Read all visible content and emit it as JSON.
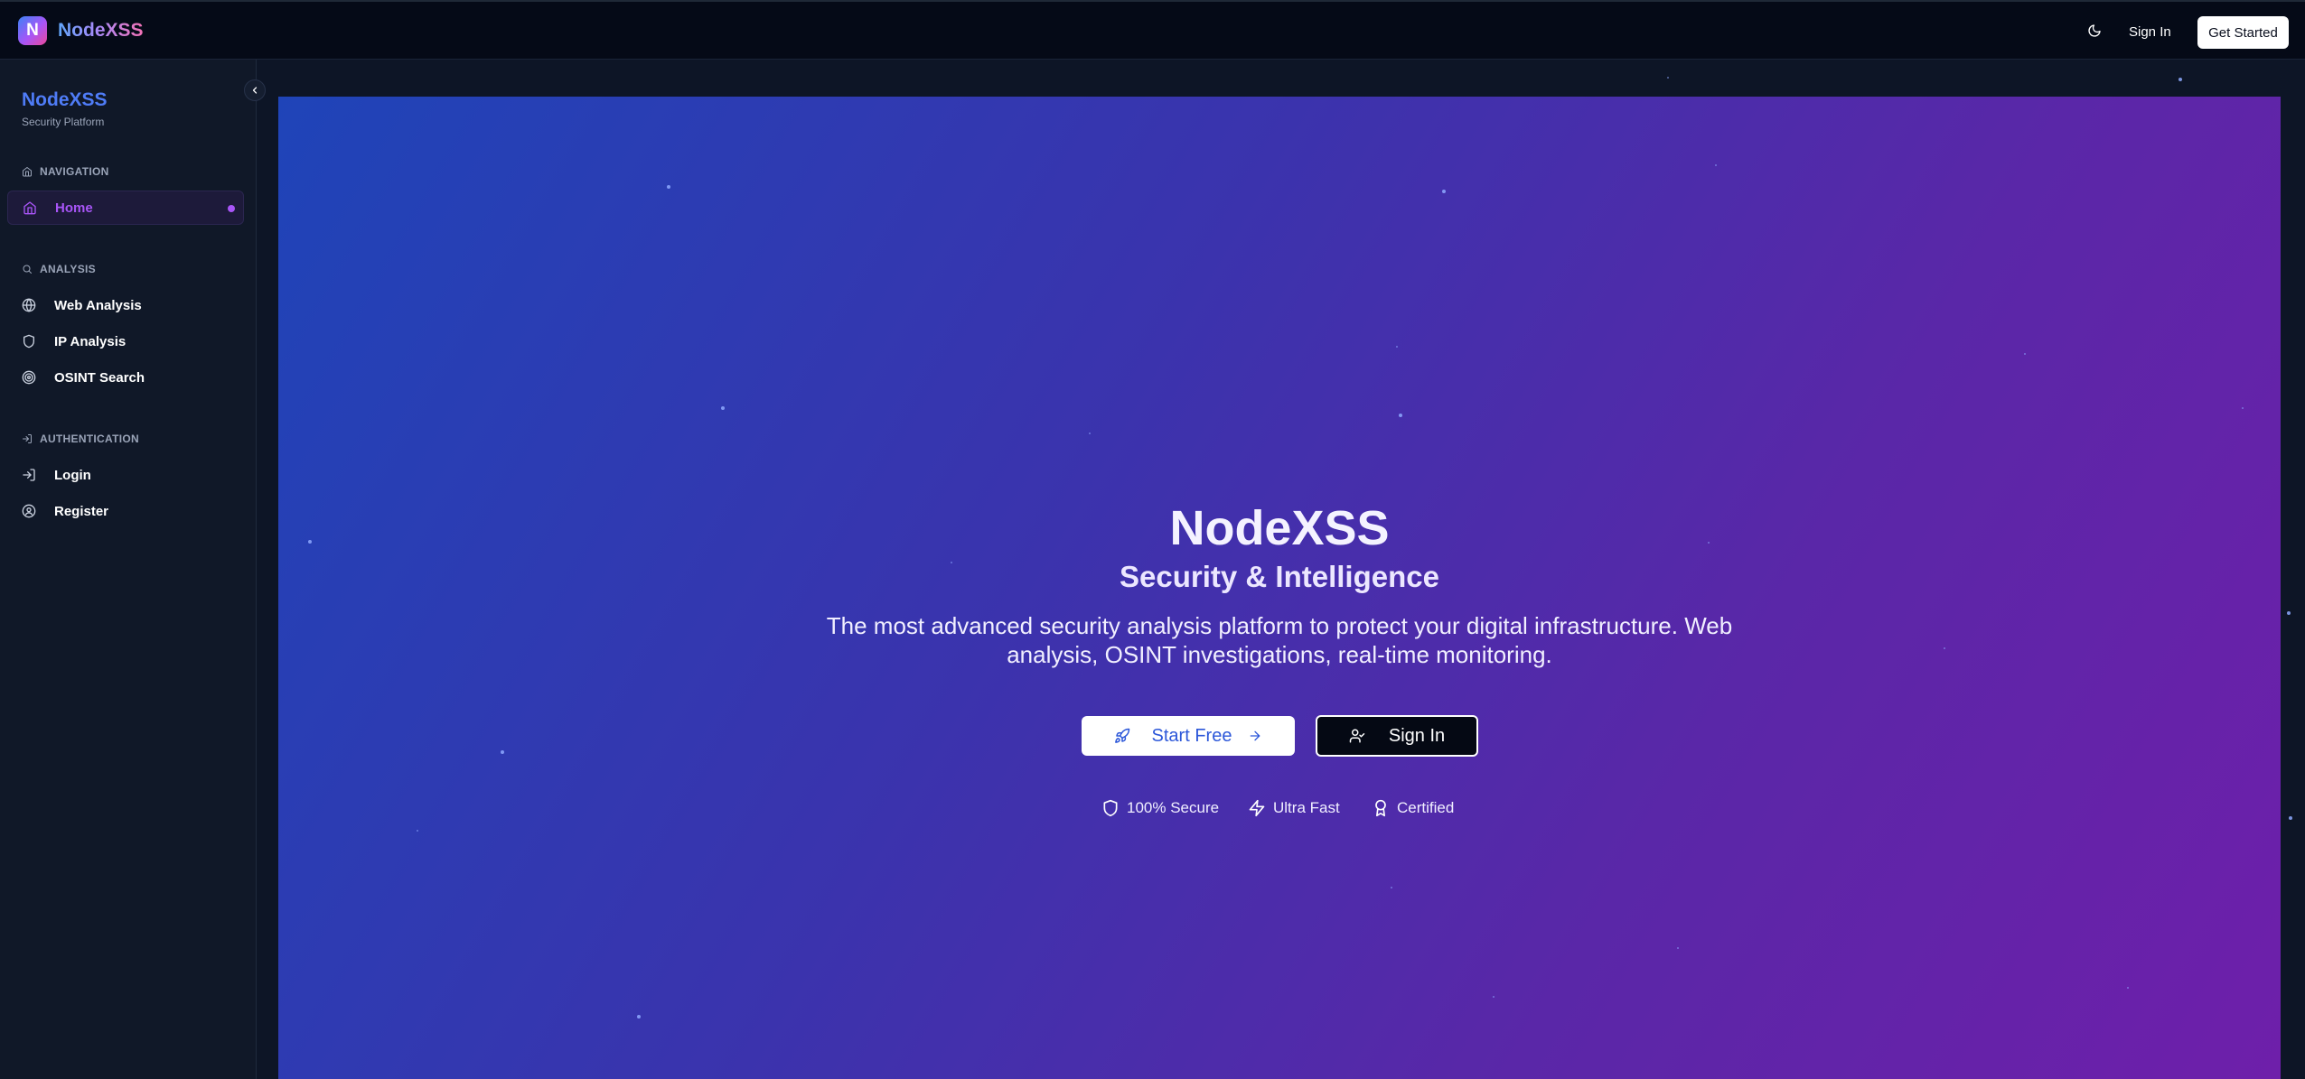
{
  "topbar": {
    "logo_letter": "N",
    "brand_name": "NodeXSS",
    "theme_icon": "moon-icon",
    "sign_in_label": "Sign In",
    "get_started_label": "Get Started"
  },
  "sidebar": {
    "title": "NodeXSS",
    "subtitle": "Security Platform",
    "collapse_icon": "chevron-left-icon",
    "sections": [
      {
        "label": "NAVIGATION",
        "icon": "home-icon",
        "items": [
          {
            "label": "Home",
            "icon": "home-icon",
            "active": true
          }
        ]
      },
      {
        "label": "ANALYSIS",
        "icon": "search-icon",
        "items": [
          {
            "label": "Web Analysis",
            "icon": "globe-icon"
          },
          {
            "label": "IP Analysis",
            "icon": "shield-icon"
          },
          {
            "label": "OSINT Search",
            "icon": "radar-icon"
          }
        ]
      },
      {
        "label": "AUTHENTICATION",
        "icon": "login-icon",
        "items": [
          {
            "label": "Login",
            "icon": "login-icon"
          },
          {
            "label": "Register",
            "icon": "user-circle-icon"
          }
        ]
      }
    ]
  },
  "hero": {
    "title": "NodeXSS",
    "subtitle": "Security & Intelligence",
    "description": "The most advanced security analysis platform to protect your digital infrastructure. Web analysis, OSINT investigations, real-time monitoring.",
    "primary_button": {
      "label": "Start Free",
      "icon": "rocket-icon",
      "trailing_icon": "arrow-right-icon"
    },
    "secondary_button": {
      "label": "Sign In",
      "icon": "user-check-icon"
    },
    "badges": [
      {
        "label": "100% Secure",
        "icon": "shield-icon"
      },
      {
        "label": "Ultra Fast",
        "icon": "lightning-icon"
      },
      {
        "label": "Certified",
        "icon": "award-icon"
      }
    ]
  },
  "colors": {
    "accent_purple": "#a855f7",
    "brand_blue": "#4f7cf7",
    "hero_gradient_start": "#1f44b8",
    "hero_gradient_end": "#6e1faa"
  }
}
